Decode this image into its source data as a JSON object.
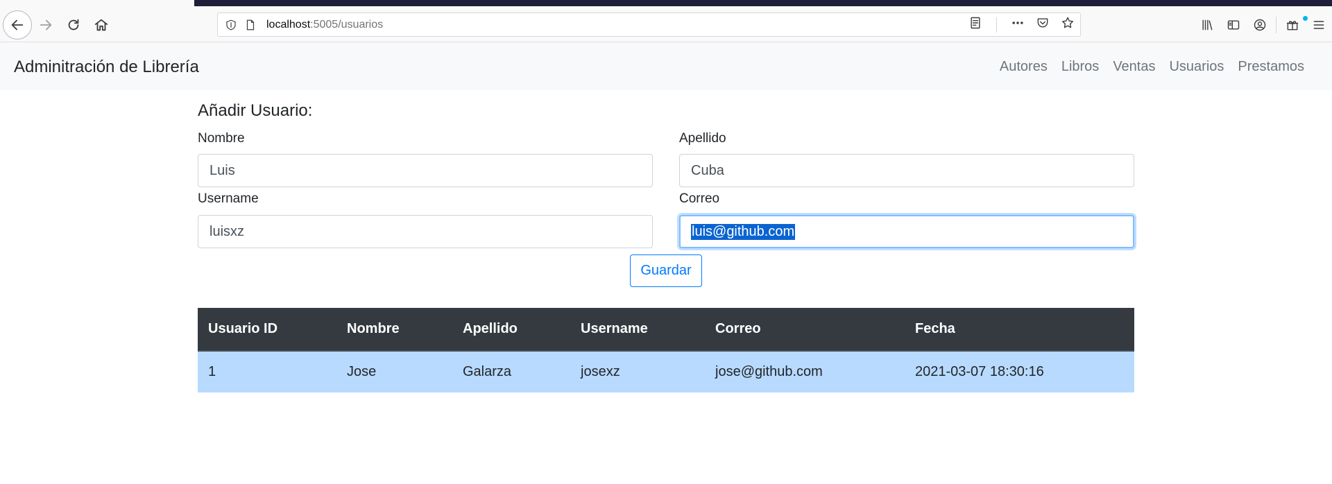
{
  "browser": {
    "url_host": "localhost",
    "url_rest": ":5005/usuarios"
  },
  "navbar": {
    "brand": "Adminitración de Librería",
    "links": [
      "Autores",
      "Libros",
      "Ventas",
      "Usuarios",
      "Prestamos"
    ]
  },
  "form": {
    "title": "Añadir Usuario:",
    "nombre_label": "Nombre",
    "nombre_value": "Luis",
    "apellido_label": "Apellido",
    "apellido_value": "Cuba",
    "username_label": "Username",
    "username_value": "luisxz",
    "correo_label": "Correo",
    "correo_value": "luis@github.com",
    "save_label": "Guardar"
  },
  "table": {
    "headers": [
      "Usuario ID",
      "Nombre",
      "Apellido",
      "Username",
      "Correo",
      "Fecha"
    ],
    "rows": [
      [
        "1",
        "Jose",
        "Galarza",
        "josexz",
        "jose@github.com",
        "2021-03-07 18:30:16"
      ]
    ]
  },
  "colors": {
    "navbar_bg": "#f8f9fa",
    "table_header_bg": "#343a40",
    "table_row_bg": "#b8daff",
    "primary": "#007bff",
    "selection": "#0a64d0"
  }
}
